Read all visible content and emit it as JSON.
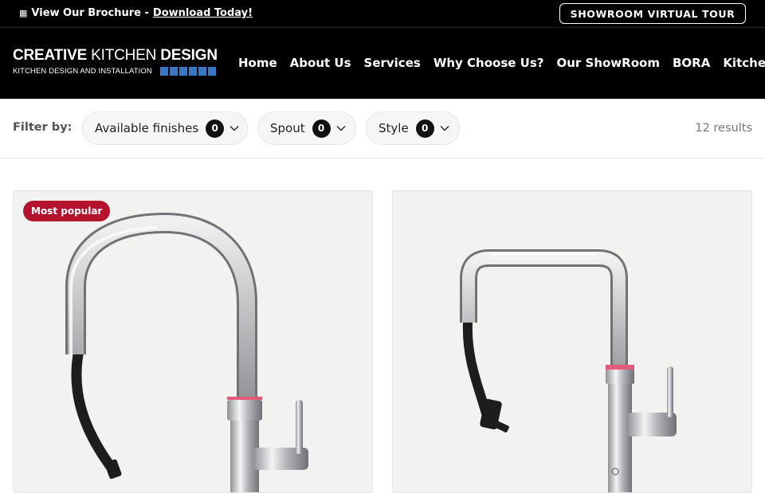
{
  "topbar": {
    "brochure_text": "View Our Brochure - ",
    "brochure_link": "Download Today!",
    "tour_button": "SHOWROOM VIRTUAL TOUR"
  },
  "logo": {
    "line1_bold_a": "CREATIVE",
    "line1_thin": " KITCHEN ",
    "line1_bold_b": "DESIGN",
    "line2": "KITCHEN DESIGN AND INSTALLATION"
  },
  "nav": {
    "items": [
      "Home",
      "About Us",
      "Services",
      "Why Choose Us?",
      "Our ShowRoom",
      "BORA",
      "Kitchen"
    ]
  },
  "filters": {
    "label": "Filter by:",
    "pills": [
      {
        "label": "Available finishes",
        "count": "0"
      },
      {
        "label": "Spout",
        "count": "0"
      },
      {
        "label": "Style",
        "count": "0"
      }
    ],
    "results": "12 results"
  },
  "products": [
    {
      "badge": "Most popular",
      "image": "round-spout-chrome-tap-image"
    },
    {
      "image": "square-spout-chrome-tap-image"
    }
  ],
  "colors": {
    "header_bg": "#000000",
    "badge_red": "#b5122e",
    "logo_blue": "#3a78c4",
    "card_bg": "#f2f2f1"
  }
}
